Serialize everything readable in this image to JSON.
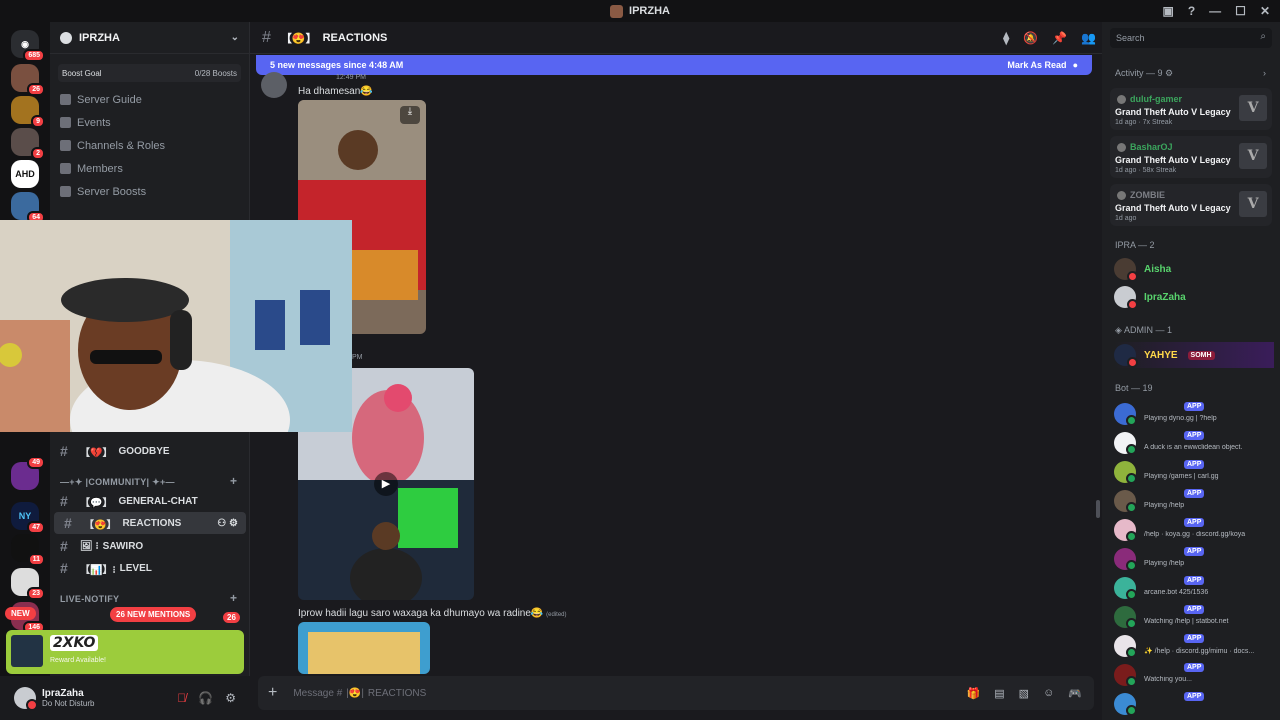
{
  "window": {
    "title": "IPRZHA"
  },
  "server": {
    "name": "IPRZHA",
    "boost_label": "Boost Goal",
    "boost_value": "0/28 Boosts",
    "nav": [
      "Server Guide",
      "Events",
      "Channels & Roles",
      "Members",
      "Server Boosts"
    ]
  },
  "guilds": [
    {
      "label": "",
      "badge": "685"
    },
    {
      "label": "",
      "badge": "26"
    },
    {
      "label": "",
      "badge": "9"
    },
    {
      "label": "",
      "badge": "2"
    },
    {
      "label": "AHD",
      "badge": ""
    },
    {
      "label": "",
      "badge": "64"
    },
    {
      "label": "",
      "badge": "49"
    },
    {
      "label": "NY",
      "badge": "47"
    },
    {
      "label": "",
      "badge": "11"
    },
    {
      "label": "",
      "badge": "23"
    },
    {
      "label": "",
      "badge": "146"
    }
  ],
  "channels": {
    "goodbye": "GOODBYE",
    "category_community": "—+✦ |COMMUNITY| ✦+—",
    "general_chat": "GENERAL-CHAT",
    "reactions": "REACTIONS",
    "sawiro": "SAWIRO",
    "level": "LEVEL",
    "category_live": "LIVE-NOTIFY",
    "new_mentions": "26 NEW MENTIONS",
    "mentions_count": "26",
    "new_pill": "NEW"
  },
  "promo": {
    "title": "2XKO",
    "subtitle": "Reward Available!"
  },
  "user": {
    "name": "IpraZaha",
    "status": "Do Not Disturb"
  },
  "main": {
    "channel_name": "REACTIONS",
    "new_messages": "5 new messages since 4:48 AM",
    "mark_as_read": "Mark As Read",
    "msg1_time": "12:49 PM",
    "msg1_text": "Ha dhamesan😂",
    "msg2_time": "PM",
    "msg3_text": "Iprow hadii lagu saro waxaga ka dhumayo wa radine😂",
    "msg3_edited": "(edited)",
    "input_placeholder": "Message #",
    "input_channel": "REACTIONS"
  },
  "members": {
    "search_placeholder": "Search",
    "activity_header": "Activity — 9",
    "activities": [
      {
        "user": "duluf-gamer",
        "game": "Grand Theft Auto V Legacy",
        "meta": "1d ago · 7x Streak",
        "color": "#3ba55d"
      },
      {
        "user": "BasharOJ",
        "game": "Grand Theft Auto V Legacy",
        "meta": "1d ago · 58x Streak",
        "color": "#3ba55d"
      },
      {
        "user": "ZOMBIE",
        "game": "Grand Theft Auto V Legacy",
        "meta": "1d ago",
        "color": "#7d7f86"
      }
    ],
    "ipra_header": "IPRA — 2",
    "ipra_members": [
      "Aisha",
      "IpraZaha"
    ],
    "admin_header": "ADMIN — 1",
    "admin_member": "YAHYE",
    "admin_tag": "SOMH",
    "bot_header": "Bot — 19",
    "app_tag": "APP",
    "bots": [
      "Playing dyno.gg | ?help",
      "A duck is an ewwclidean object.",
      "Playing /games | carl.gg",
      "Playing /help",
      "/help · koya.gg · discord.gg/koya",
      "Playing /help",
      "arcane.bot 425/1536",
      "Watching /help | statbot.net",
      "✨ /help · discord.gg/mimu · docs...",
      "Watching you...",
      ""
    ]
  },
  "colors": {
    "accent": "#5865f2",
    "danger": "#f23f43",
    "online": "#23a559",
    "promo": "#9ccc3c"
  }
}
